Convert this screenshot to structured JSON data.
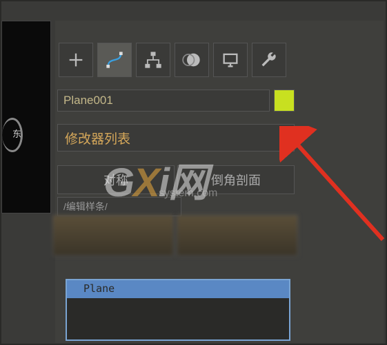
{
  "viewport": {
    "orientation_label": "东"
  },
  "toolbar": {
    "create_icon": "plus",
    "modify_icon": "bezier",
    "hierarchy_icon": "hierarchy",
    "motion_icon": "circle",
    "display_icon": "monitor",
    "utilities_icon": "wrench"
  },
  "object": {
    "name": "Plane001",
    "color": "#c8e020"
  },
  "modifier": {
    "dropdown_label": "修改器列表",
    "button_symmetry": "对称",
    "button_chamfer": "倒角剖面",
    "preset_label": "/编辑样条/"
  },
  "stack": {
    "items": [
      "Plane"
    ]
  },
  "watermark": {
    "main_g": "G",
    "main_x": "X",
    "main_i": "i",
    "main_net": "网",
    "sub": "system.com"
  }
}
